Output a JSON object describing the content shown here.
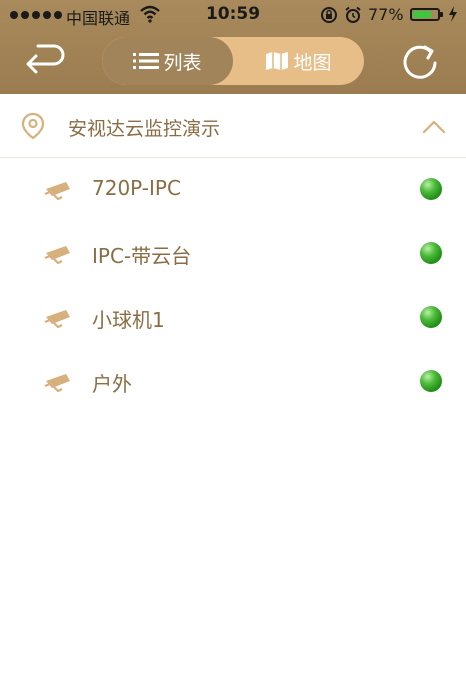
{
  "status_bar": {
    "carrier": "中国联通",
    "time": "10:59",
    "battery_percent_label": "77%",
    "battery_level": 0.77
  },
  "nav": {
    "back_icon": "back-arrow-icon",
    "refresh_icon": "refresh-icon",
    "segments": [
      {
        "label": "列表",
        "icon": "list-icon",
        "active": true
      },
      {
        "label": "地图",
        "icon": "map-icon",
        "active": false
      }
    ]
  },
  "group": {
    "title": "安视达云监控演示",
    "icon": "location-pin-icon",
    "expanded": true
  },
  "devices": [
    {
      "name": "720P-IPC",
      "status": "online"
    },
    {
      "name": "IPC-带云台",
      "status": "online"
    },
    {
      "name": "小球机1",
      "status": "online"
    },
    {
      "name": "户外",
      "status": "online"
    }
  ],
  "colors": {
    "header": "#a88a5c",
    "segment_inactive": "#e7bd88",
    "text_accent": "#8a6d45",
    "icon_accent": "#d8b07c",
    "status_online": "#2ea52a"
  }
}
